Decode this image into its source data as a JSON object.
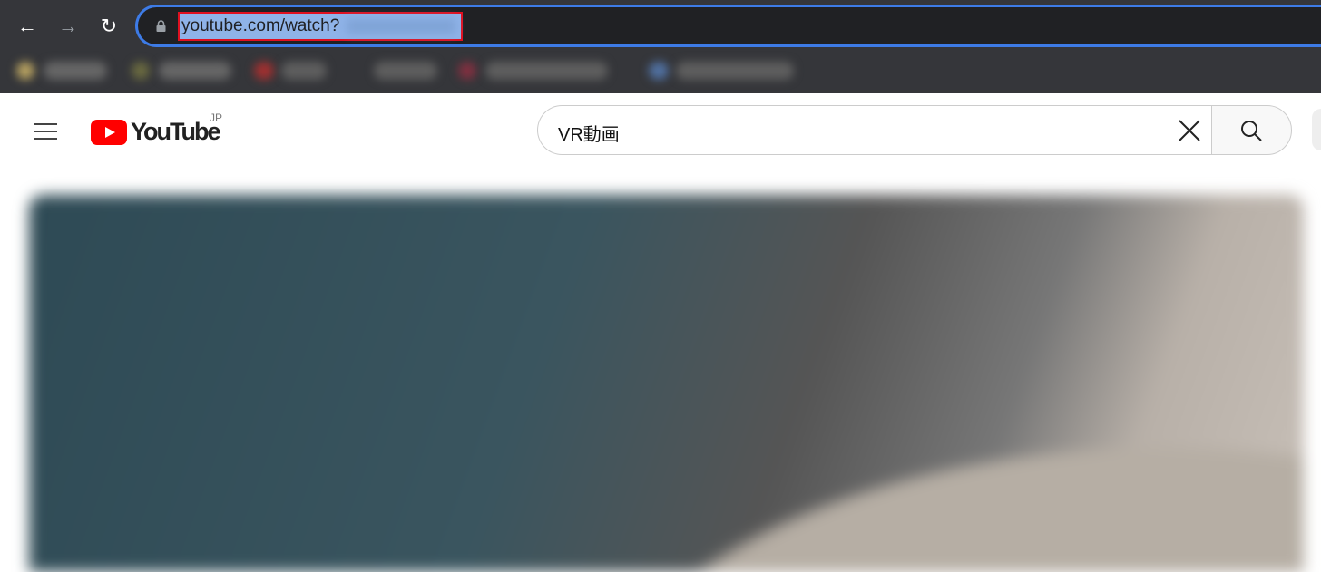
{
  "browser": {
    "back_icon": "arrow-left-icon",
    "forward_icon": "arrow-right-icon",
    "reload_icon": "reload-icon",
    "lock_icon": "lock-icon",
    "url": "youtube.com/watch?",
    "highlight_color": "#e01020"
  },
  "youtube": {
    "menu_icon": "hamburger-icon",
    "logo_text": "YouTube",
    "region": "JP",
    "brand_color": "#ff0000",
    "search": {
      "value": "VR動画",
      "clear_icon": "close-icon",
      "search_icon": "search-icon"
    }
  }
}
